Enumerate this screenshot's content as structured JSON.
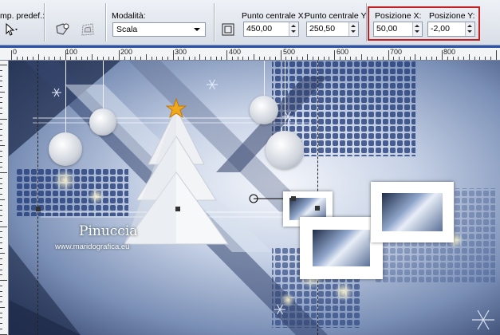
{
  "toolbar": {
    "preset_label": "mp. predef.:",
    "mode_label": "Modalità:",
    "mode_value": "Scala",
    "center_x_label": "Punto centrale X:",
    "center_x_value": "450,00",
    "center_y_label": "Punto centrale Y:",
    "center_y_value": "250,50",
    "pos_x_label": "Posizione X:",
    "pos_x_value": "50,00",
    "pos_y_label": "Posizione Y:",
    "pos_y_value": "-2,00",
    "highlight_color": "#c42020"
  },
  "ruler": {
    "labels": [
      "0",
      "100",
      "200",
      "300",
      "400",
      "500",
      "600",
      "700",
      "800"
    ]
  },
  "canvas": {
    "watermark_name": "Pinuccia",
    "watermark_site": "www.maridografica.eu"
  },
  "icons": [
    "pick-tool-icon",
    "deform-tool-icon",
    "perspective-tool-icon",
    "center-point-icon"
  ]
}
